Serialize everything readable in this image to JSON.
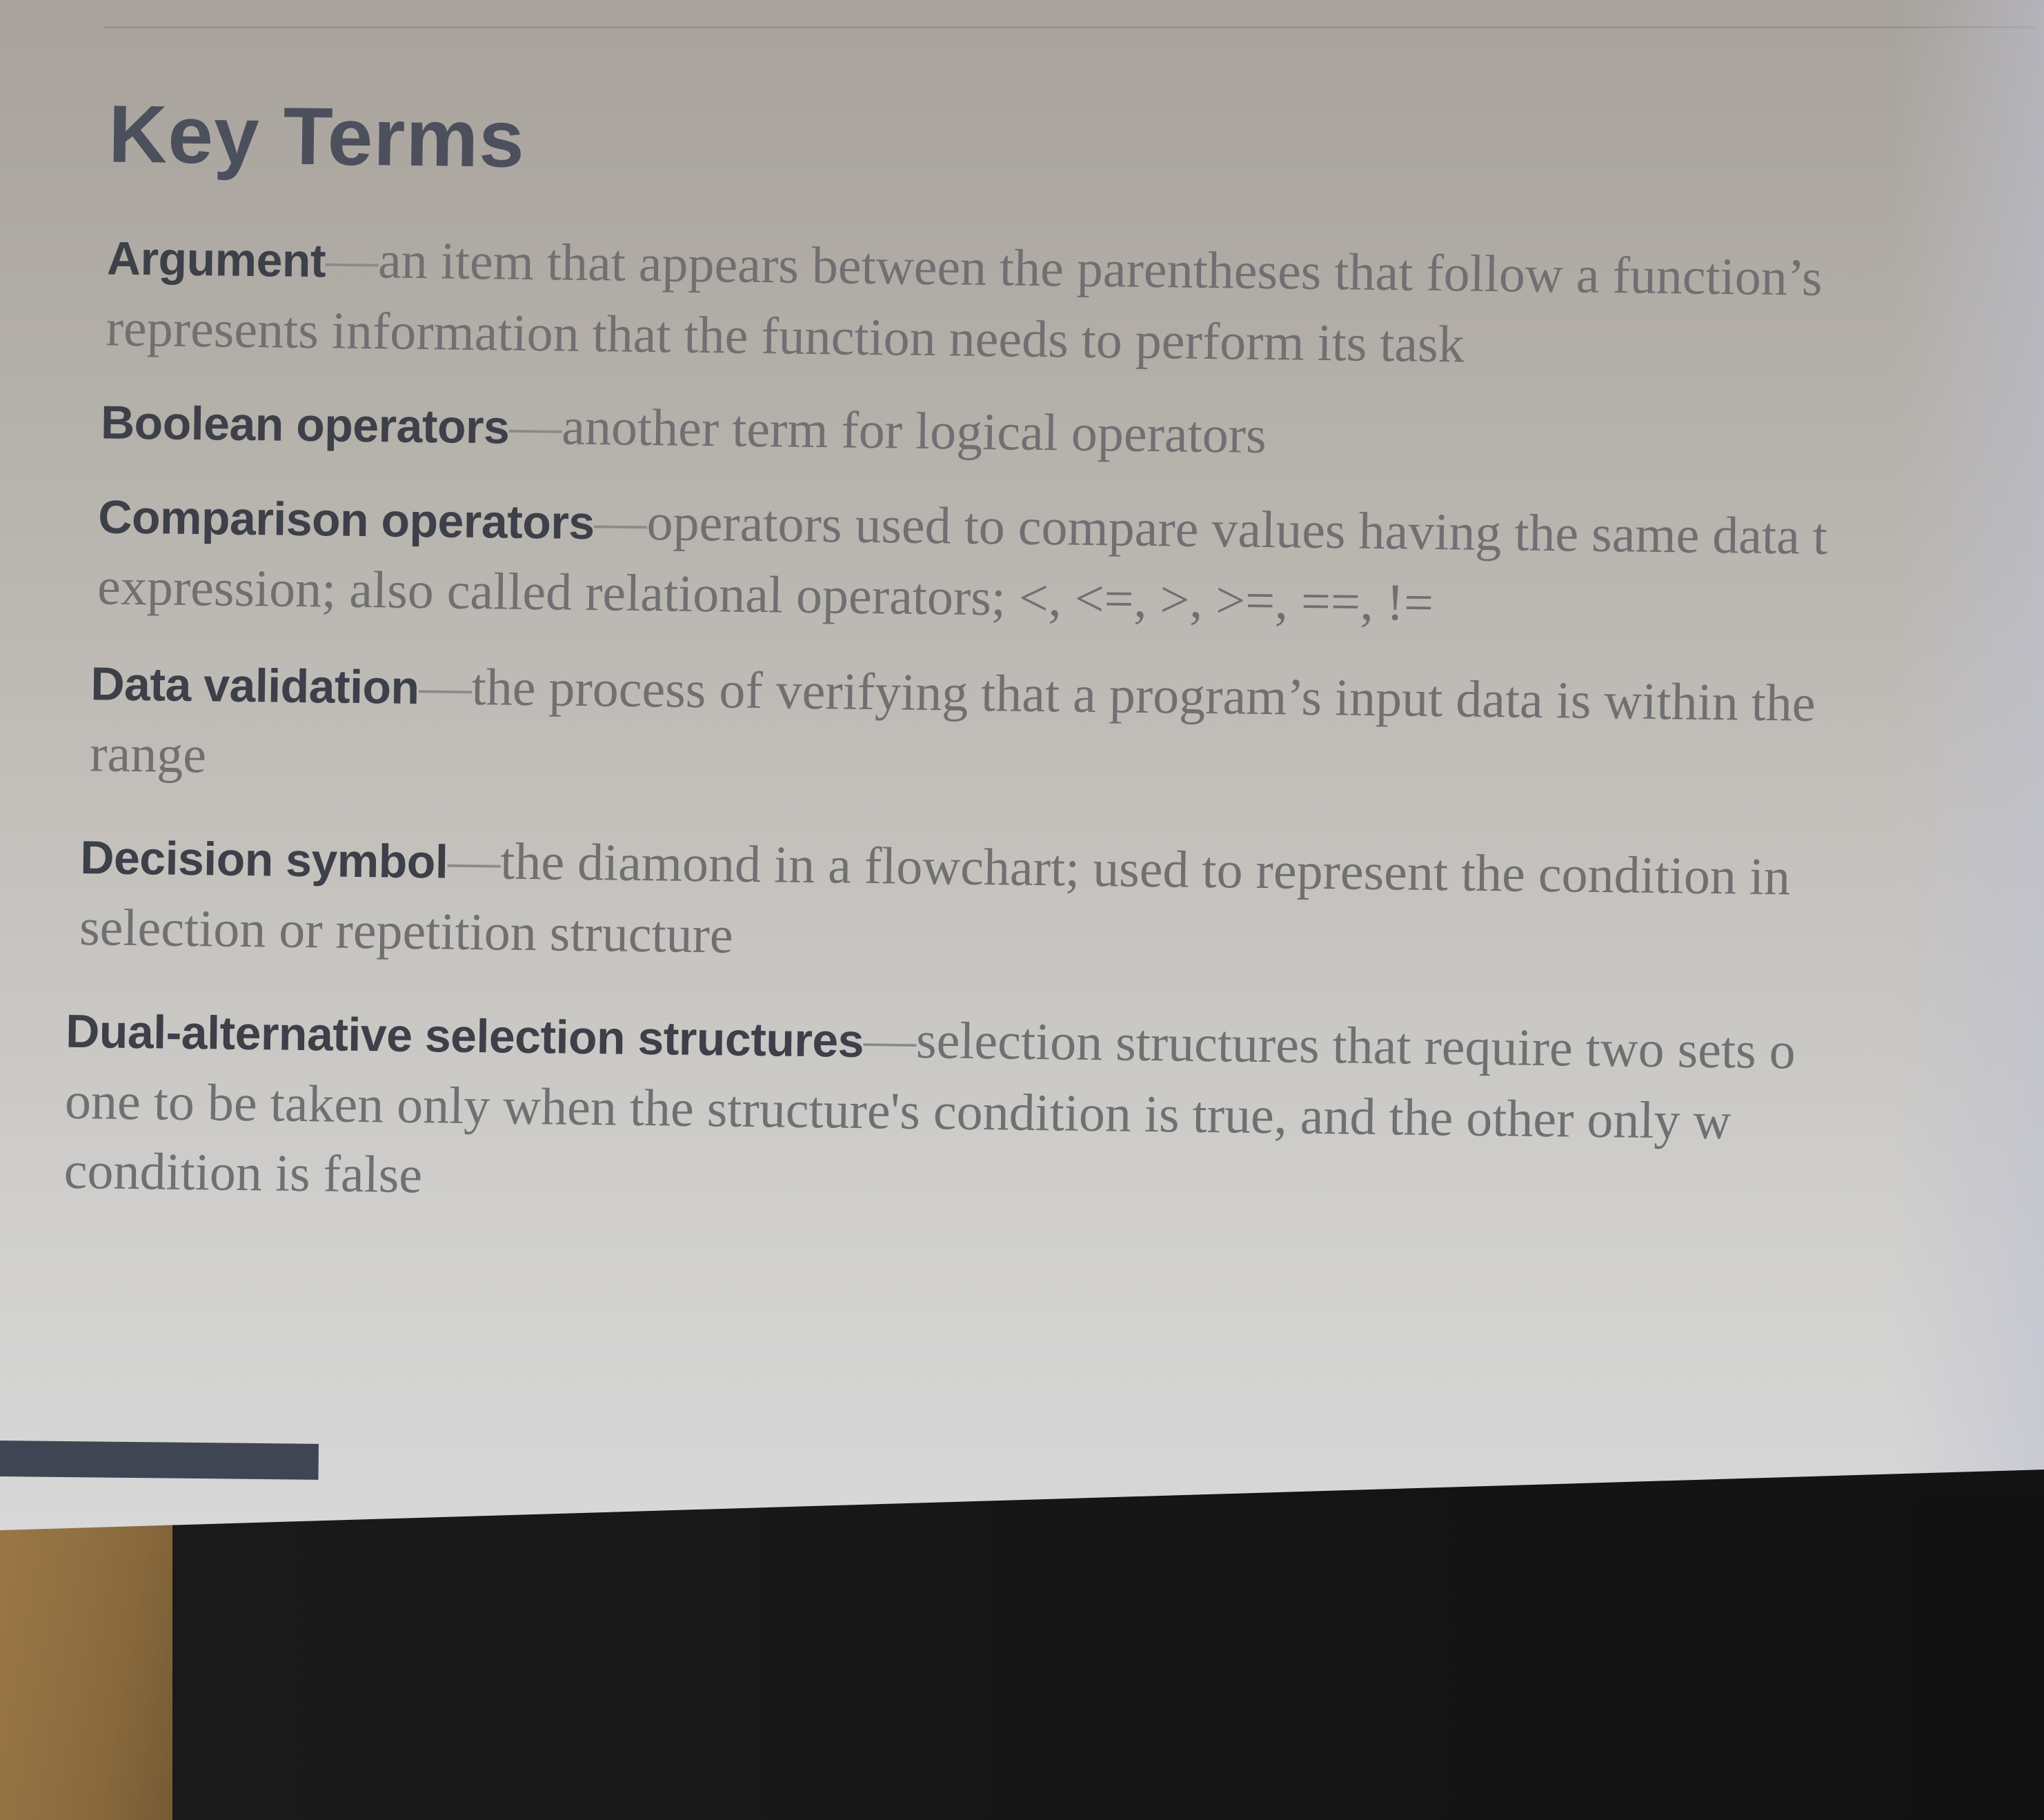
{
  "heading": "Key Terms",
  "entries": [
    {
      "term": "Argument",
      "dash": "—",
      "line1": "an item that appears between the parentheses that follow a function’s",
      "line2": "represents information that the function needs to perform its task"
    },
    {
      "term": "Boolean operators",
      "dash": "—",
      "line1": "another term for logical operators"
    },
    {
      "term": "Comparison operators",
      "dash": "—",
      "line1": "operators used to compare values having the same data t",
      "line2": "expression; also called relational operators; <, <=, >, >=, ==, !="
    },
    {
      "term": "Data validation",
      "dash": "—",
      "line1": "the process of verifying that a program’s input data is within the",
      "line2": "range"
    },
    {
      "term": "Decision symbol",
      "dash": "—",
      "line1": "the diamond in a flowchart; used to represent the condition in",
      "line2": "selection or repetition structure"
    },
    {
      "term": "Dual-alternative selection structures",
      "dash": "—",
      "line1": "selection structures that require two sets o",
      "line2": "one to be taken only when the structure's condition is true, and the other only w",
      "line3": "condition is false"
    }
  ]
}
